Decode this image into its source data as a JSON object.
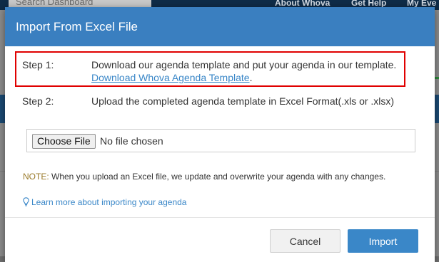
{
  "background": {
    "search_placeholder": "Search Dashboard",
    "nav": [
      "About Whova",
      "Get Help",
      "My Eve"
    ]
  },
  "modal": {
    "title": "Import From Excel File",
    "step1": {
      "label": "Step 1:",
      "text": "Download our agenda template and put your agenda in our template.",
      "link": "Download Whova Agenda Template",
      "link_suffix": "."
    },
    "step2": {
      "label": "Step 2:",
      "text": "Upload the completed agenda template in Excel Format(.xls or .xlsx)"
    },
    "file_input": {
      "button_label": "Choose File",
      "status": "No file chosen"
    },
    "note": {
      "prefix": "NOTE:",
      "text": " When you upload an Excel file, we update and overwrite your agenda with any changes."
    },
    "learn_more": {
      "icon": "lightbulb-icon",
      "text": "Learn more about importing your agenda"
    },
    "buttons": {
      "cancel": "Cancel",
      "import": "Import"
    }
  },
  "colors": {
    "header": "#3a7fc0",
    "link": "#3a87c8",
    "highlight": "#e00000",
    "primary_button": "#3a87c8"
  }
}
